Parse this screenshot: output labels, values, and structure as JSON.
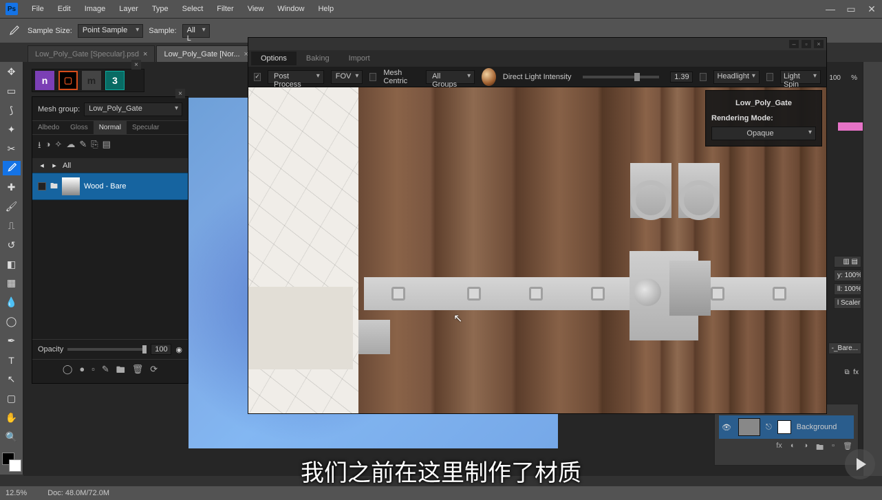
{
  "menu": {
    "items": [
      "File",
      "Edit",
      "Image",
      "Layer",
      "Type",
      "Select",
      "Filter",
      "View",
      "Window",
      "Help"
    ]
  },
  "options_bar": {
    "sample_size_label": "Sample Size:",
    "sample_size_value": "Point Sample",
    "sample_label": "Sample:",
    "sample_value": "All L"
  },
  "tabs": {
    "inactive": "Low_Poly_Gate [Specular].psd",
    "active": "Low_Poly_Gate [Nor..."
  },
  "ddo": {
    "mesh_group_label": "Mesh group:",
    "mesh_group_value": "Low_Poly_Gate",
    "map_tabs": [
      "Albedo",
      "Gloss",
      "Normal",
      "Specular"
    ],
    "active_map_tab": 2,
    "all_label": "All",
    "layer_name": "Wood - Bare",
    "opacity_label": "Opacity",
    "opacity_value": "100"
  },
  "preview": {
    "tabs": [
      "Options",
      "Baking",
      "Import"
    ],
    "active_tab": 0,
    "post_process": "Post Process",
    "fov": "FOV",
    "mesh_centric": "Mesh Centric",
    "all_groups": "All Groups",
    "light_label": "Direct Light Intensity",
    "light_value": "1.39",
    "headlight": "Headlight",
    "light_spin": "Light Spin",
    "info_title": "Low_Poly_Gate",
    "render_mode_label": "Rendering Mode:",
    "render_mode_value": "Opaque"
  },
  "right_panel": {
    "percent_value": "100",
    "percent_sym": "%",
    "opacity_y": "y:",
    "opacity_val": "100%",
    "fill_l": "ll:",
    "fill_val": "100%",
    "scaler": "l Scaler",
    "bare_tag": "-_Bare...",
    "fx_label": "fx",
    "link_icon": "⧉",
    "bg_label": "Background"
  },
  "status": {
    "zoom": "12.5%",
    "doc": "Doc: 48.0M/72.0M"
  },
  "subtitle": "我们之前在这里制作了材质"
}
